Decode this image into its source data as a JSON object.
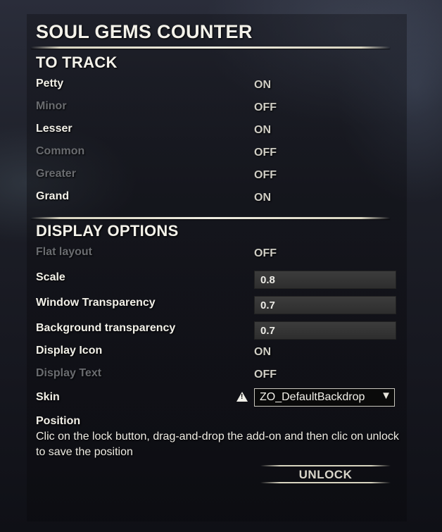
{
  "title": "SOUL GEMS COUNTER",
  "to_track": {
    "heading": "TO TRACK",
    "items": [
      {
        "label": "Petty",
        "value": "ON"
      },
      {
        "label": "Minor",
        "value": "OFF"
      },
      {
        "label": "Lesser",
        "value": "ON"
      },
      {
        "label": "Common",
        "value": "OFF"
      },
      {
        "label": "Greater",
        "value": "OFF"
      },
      {
        "label": "Grand",
        "value": "ON"
      }
    ]
  },
  "display_options": {
    "heading": "DISPLAY OPTIONS",
    "flat_layout": {
      "label": "Flat layout",
      "value": "OFF"
    },
    "scale": {
      "label": "Scale",
      "value": "0.8"
    },
    "window_transparency": {
      "label": "Window Transparency",
      "value": "0.7"
    },
    "background_transparency": {
      "label": "Background transparency",
      "value": "0.7"
    },
    "display_icon": {
      "label": "Display Icon",
      "value": "ON"
    },
    "display_text": {
      "label": "Display Text",
      "value": "OFF"
    },
    "skin": {
      "label": "Skin",
      "value": "ZO_DefaultBackdrop",
      "warning_icon": "warning-icon"
    },
    "position": {
      "label": "Position",
      "description": "Clic on the lock button, drag-and-drop the add-on and then clic on unlock to save the position",
      "button": "UNLOCK"
    }
  }
}
